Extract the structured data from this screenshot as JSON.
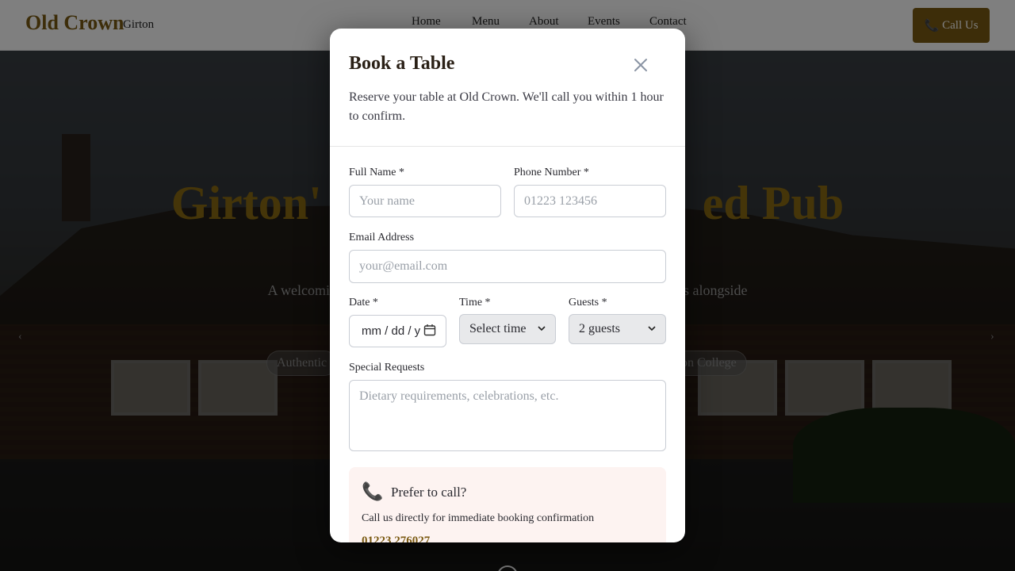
{
  "navbar": {
    "brand": "Old Crown",
    "brand_sub": "Girton",
    "links": [
      "Home",
      "Menu",
      "About",
      "Events",
      "Contact"
    ],
    "call_button": "Call Us"
  },
  "hero": {
    "title_left": "Girton'",
    "title_right": "ed Pub",
    "subtitle_left": "A welcoming",
    "subtitle_right": "es alongside",
    "tag_left": "Authentic",
    "tag_right": "on College",
    "prev_arrow": "‹",
    "next_arrow": "›"
  },
  "modal": {
    "title": "Book a Table",
    "description": "Reserve your table at Old Crown. We'll call you within 1 hour to confirm.",
    "full_name_label": "Full Name *",
    "full_name_placeholder": "Your name",
    "phone_label": "Phone Number *",
    "phone_placeholder": "01223 123456",
    "email_label": "Email Address",
    "email_placeholder": "your@email.com",
    "date_label": "Date *",
    "date_value": "mm / dd / y",
    "time_label": "Time *",
    "time_value": "Select time",
    "guests_label": "Guests *",
    "guests_value": "2 guests",
    "requests_label": "Special Requests",
    "requests_placeholder": "Dietary requirements, celebrations, etc.",
    "call_box": {
      "title": "Prefer to call?",
      "text": "Call us directly for immediate booking confirmation",
      "phone": "01223 276027"
    }
  },
  "colors": {
    "brand": "#7a5a12",
    "call_box_bg": "#fdf3f1"
  }
}
